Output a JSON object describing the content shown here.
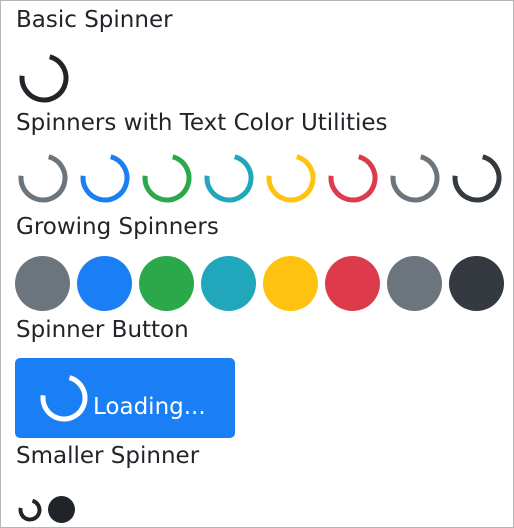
{
  "sections": {
    "basic": "Basic Spinner",
    "colors": "Spinners with Text Color Utilities",
    "growing": "Growing Spinners",
    "button": "Spinner Button",
    "small": "Smaller Spinner"
  },
  "button": {
    "label": "Loading..."
  },
  "colors": {
    "dark": "#212529",
    "secondary": "#6c757d",
    "primary": "#1a7ff4",
    "success": "#2aa84a",
    "info": "#20a7bc",
    "warning": "#ffc20e",
    "danger": "#dd3b4b",
    "darkgray": "#343a40"
  }
}
